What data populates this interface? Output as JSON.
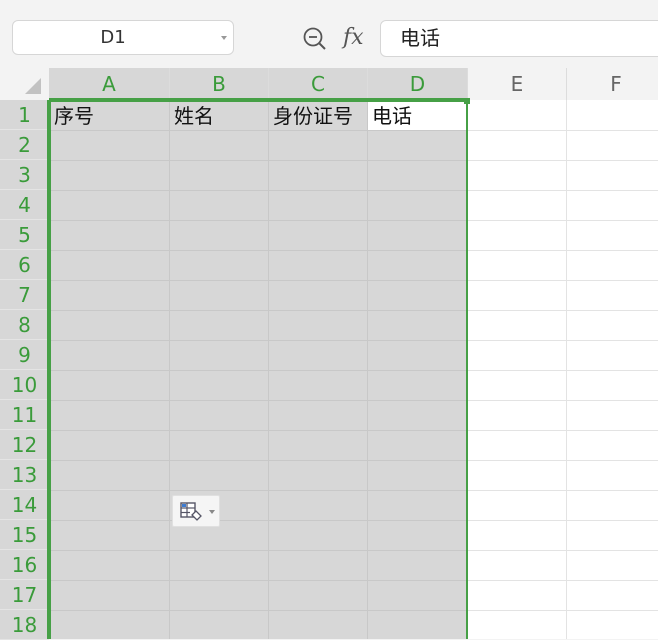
{
  "name_box": {
    "value": "D1"
  },
  "formula_bar": {
    "value": "电话",
    "fx_label": "fx"
  },
  "columns": [
    "A",
    "B",
    "C",
    "D",
    "E",
    "F"
  ],
  "rows": [
    "1",
    "2",
    "3",
    "4",
    "5",
    "6",
    "7",
    "8",
    "9",
    "10",
    "11",
    "12",
    "13",
    "14",
    "15",
    "16",
    "17",
    "18"
  ],
  "cells": {
    "A1": "序号",
    "B1": "姓名",
    "C1": "身份证号",
    "D1": "电话"
  },
  "icons": {
    "zoom": "zoom-out-icon",
    "paste_options": "paste-options-icon"
  },
  "colors": {
    "selection_green": "#46a046",
    "selection_fill": "#d7d7d7"
  }
}
